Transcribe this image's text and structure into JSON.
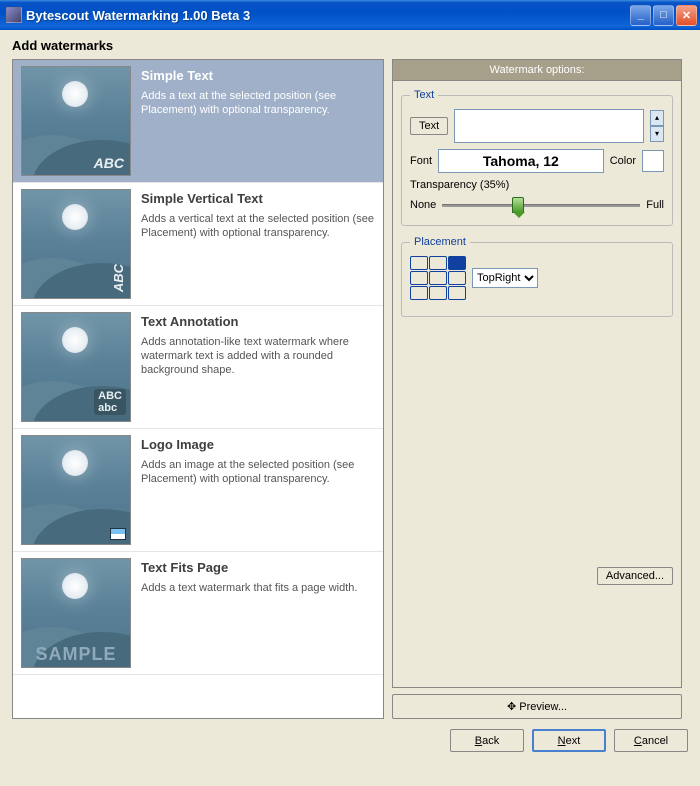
{
  "window": {
    "title": "Bytescout Watermarking 1.00 Beta 3"
  },
  "heading": "Add watermarks",
  "watermarks": [
    {
      "title": "Simple Text",
      "desc": "Adds a text at the selected position (see Placement) with optional transparency.",
      "thumb_label": "ABC",
      "selected": true
    },
    {
      "title": "Simple Vertical Text",
      "desc": "Adds a vertical text at the selected position (see Placement) with optional transparency.",
      "thumb_label": "ABC"
    },
    {
      "title": "Text Annotation",
      "desc": "Adds annotation-like text watermark where watermark text is added with a rounded background shape.",
      "thumb_label": "ABC\nabc"
    },
    {
      "title": "Logo Image",
      "desc": "Adds an image at the selected position (see Placement) with optional transparency.",
      "thumb_label": ""
    },
    {
      "title": "Text Fits Page",
      "desc": "Adds a text watermark that fits a page width.",
      "thumb_label": "SAMPLE"
    }
  ],
  "options": {
    "header": "Watermark options:",
    "text_group": "Text",
    "text_btn": "Text",
    "text_value": "",
    "font_label": "Font",
    "font_value": "Tahoma, 12",
    "color_label": "Color",
    "transparency_label": "Transparency (35%)",
    "transparency_value": 35,
    "trans_none": "None",
    "trans_full": "Full",
    "placement_group": "Placement",
    "placement_value": "TopRight",
    "placement_options": [
      "TopLeft",
      "TopCenter",
      "TopRight",
      "MiddleLeft",
      "MiddleCenter",
      "MiddleRight",
      "BottomLeft",
      "BottomCenter",
      "BottomRight"
    ],
    "advanced_btn": "Advanced...",
    "preview_btn": "Preview..."
  },
  "buttons": {
    "back": "Back",
    "next": "Next",
    "cancel": "Cancel"
  }
}
